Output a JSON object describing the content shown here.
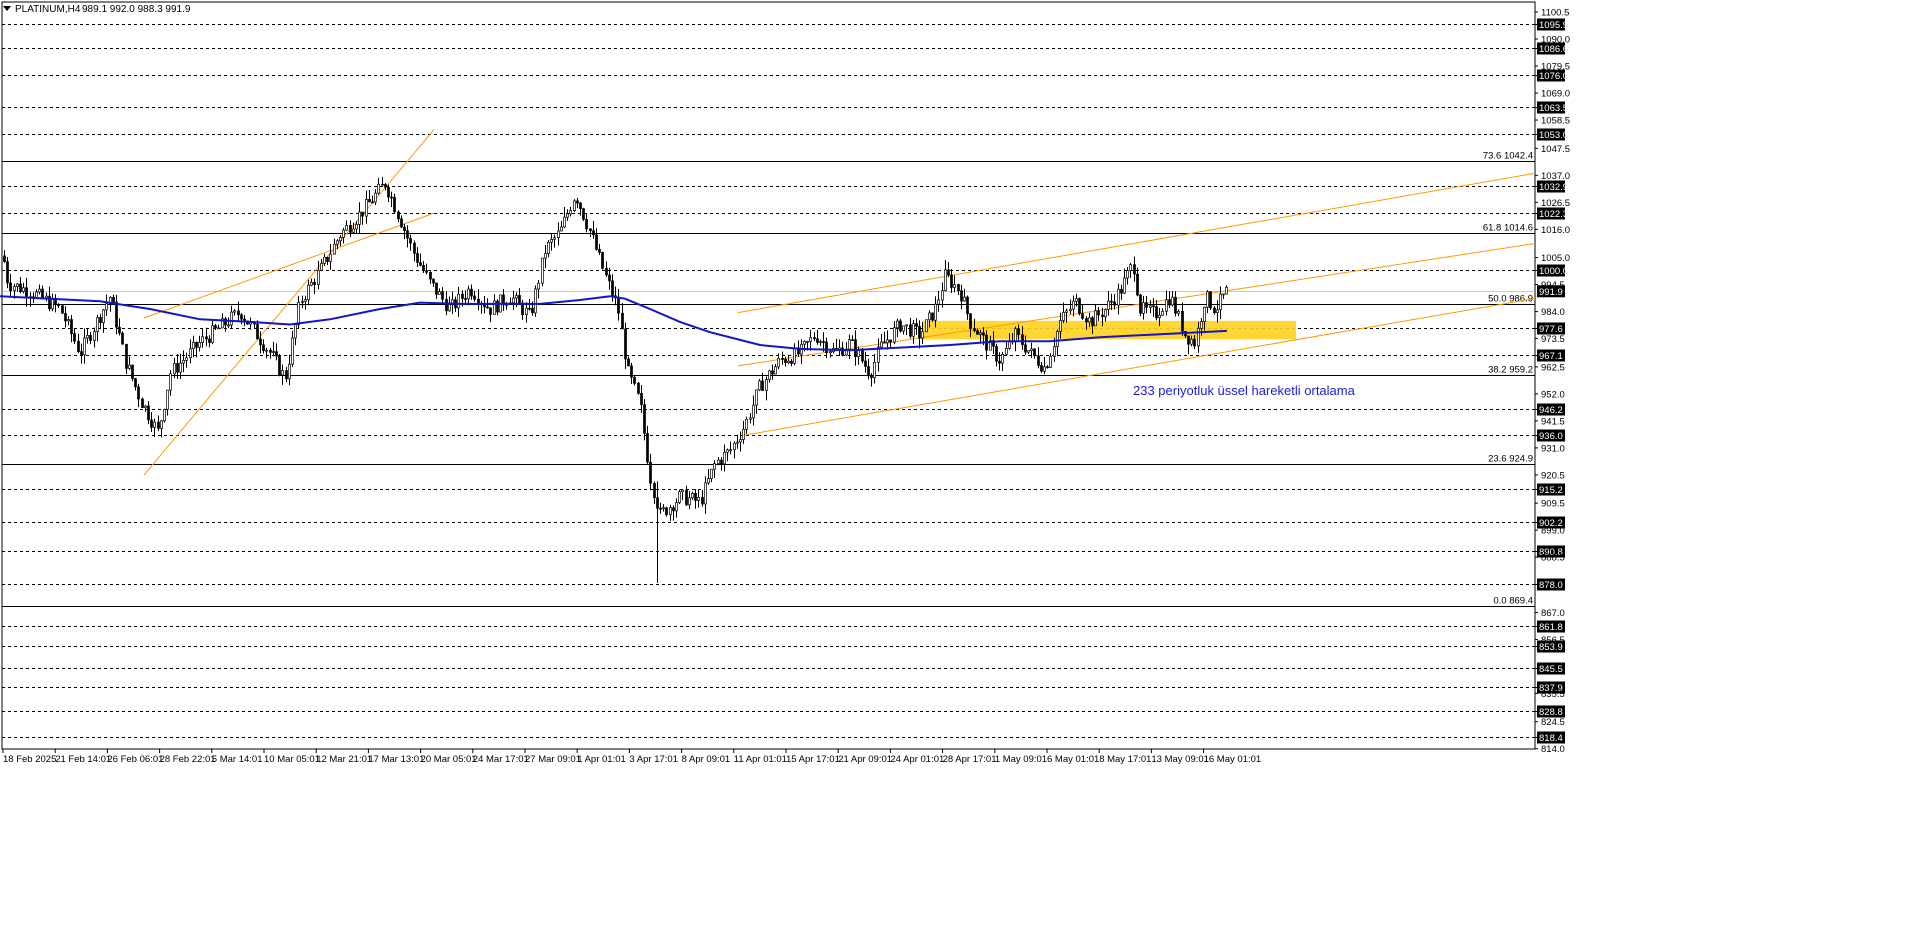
{
  "header": {
    "symbol": "PLATINUM,H4",
    "ohlc": "989.1 992.0 988.3 991.9"
  },
  "colors": {
    "candle": "#000000",
    "ema": "#1414c8",
    "channel": "#ff9900",
    "zone": "#ffd21e",
    "grid": "#000000",
    "note": "#1c1ce0"
  },
  "chart_data": {
    "type": "candlestick",
    "annotation": "233 periyotluk üssel hareketli ortalama",
    "ylim": [
      813.9,
      1104.4
    ],
    "y_ticks": [
      {
        "v": 1100.5,
        "t": "1100.5"
      },
      {
        "v": 1090.0,
        "t": "1090.0"
      },
      {
        "v": 1079.5,
        "t": "1079.5"
      },
      {
        "v": 1069.0,
        "t": "1069.0"
      },
      {
        "v": 1058.5,
        "t": "1058.5"
      },
      {
        "v": 1047.5,
        "t": "1047.5"
      },
      {
        "v": 1037.0,
        "t": "1037.0"
      },
      {
        "v": 1026.5,
        "t": "1026.5"
      },
      {
        "v": 1016.0,
        "t": "1016.0"
      },
      {
        "v": 1005.0,
        "t": "1005.0"
      },
      {
        "v": 994.5,
        "t": "994.5"
      },
      {
        "v": 984.0,
        "t": "984.0"
      },
      {
        "v": 973.5,
        "t": "973.5"
      },
      {
        "v": 962.5,
        "t": "962.5"
      },
      {
        "v": 952.0,
        "t": "952.0"
      },
      {
        "v": 941.5,
        "t": "941.5"
      },
      {
        "v": 931.0,
        "t": "931.0"
      },
      {
        "v": 920.5,
        "t": "920.5"
      },
      {
        "v": 909.5,
        "t": "909.5"
      },
      {
        "v": 899.0,
        "t": "899.0"
      },
      {
        "v": 888.5,
        "t": "888.5"
      },
      {
        "v": 867.0,
        "t": "867.0"
      },
      {
        "v": 856.5,
        "t": "856.5"
      },
      {
        "v": 835.5,
        "t": "835.5"
      },
      {
        "v": 824.5,
        "t": "824.5"
      },
      {
        "v": 814.0,
        "t": "814.0"
      }
    ],
    "dashed_levels": [
      {
        "v": 1095.9,
        "t": "1095.9"
      },
      {
        "v": 1086.6,
        "t": "1086.6"
      },
      {
        "v": 1076.0,
        "t": "1076.0"
      },
      {
        "v": 1063.5,
        "t": "1063.5"
      },
      {
        "v": 1053.0,
        "t": "1053.0"
      },
      {
        "v": 1032.9,
        "t": "1032.9"
      },
      {
        "v": 1022.3,
        "t": "1022.3"
      },
      {
        "v": 1000.0,
        "t": "1000.0"
      },
      {
        "v": 977.6,
        "t": "977.6"
      },
      {
        "v": 967.1,
        "t": "967.1"
      },
      {
        "v": 946.2,
        "t": "946.2"
      },
      {
        "v": 936.0,
        "t": "936.0"
      },
      {
        "v": 915.2,
        "t": "915.2"
      },
      {
        "v": 902.2,
        "t": "902.2"
      },
      {
        "v": 890.8,
        "t": "890.8"
      },
      {
        "v": 878.0,
        "t": "878.0"
      },
      {
        "v": 861.8,
        "t": "861.8"
      },
      {
        "v": 853.9,
        "t": "853.9"
      },
      {
        "v": 845.5,
        "t": "845.5"
      },
      {
        "v": 837.9,
        "t": "837.9"
      },
      {
        "v": 828.8,
        "t": "828.8"
      },
      {
        "v": 818.4,
        "t": "818.4"
      }
    ],
    "current_price": {
      "v": 991.9,
      "t": "991.9"
    },
    "fib_levels": [
      {
        "v": 1042.4,
        "t": "73.6 1042.4"
      },
      {
        "v": 1014.6,
        "t": "61.8 1014.6"
      },
      {
        "v": 986.9,
        "t": "50.0 986.9"
      },
      {
        "v": 959.2,
        "t": "38.2 959.2"
      },
      {
        "v": 924.9,
        "t": "23.6 924.9"
      },
      {
        "v": 869.4,
        "t": "0.0 869.4"
      }
    ],
    "x_labels": [
      "18 Feb 2025",
      "21 Feb 14:01",
      "26 Feb 06:01",
      "28 Feb 22:01",
      "5 Mar 14:01",
      "10 Mar 05:01",
      "12 Mar 21:01",
      "17 Mar 13:01",
      "20 Mar 05:01",
      "24 Mar 17:01",
      "27 Mar 09:01",
      "1 Apr 01:01",
      "3 Apr 17:01",
      "8 Apr 09:01",
      "11 Apr 01:01",
      "15 Apr 17:01",
      "21 Apr 09:01",
      "24 Apr 01:01",
      "28 Apr 17:01",
      "1 May 09:01",
      "6 May 01:01",
      "8 May 17:01",
      "13 May 09:01",
      "16 May 01:01"
    ],
    "price_path": [
      [
        0,
        1012
      ],
      [
        8,
        995
      ],
      [
        30,
        992
      ],
      [
        60,
        985
      ],
      [
        80,
        968
      ],
      [
        110,
        990
      ],
      [
        125,
        965
      ],
      [
        140,
        950
      ],
      [
        158,
        937
      ],
      [
        170,
        960
      ],
      [
        200,
        972
      ],
      [
        240,
        984
      ],
      [
        270,
        968
      ],
      [
        285,
        958
      ],
      [
        300,
        988
      ],
      [
        320,
        1000
      ],
      [
        340,
        1014
      ],
      [
        360,
        1022
      ],
      [
        385,
        1034
      ],
      [
        400,
        1020
      ],
      [
        412,
        1008
      ],
      [
        430,
        995
      ],
      [
        450,
        985
      ],
      [
        470,
        993
      ],
      [
        490,
        985
      ],
      [
        510,
        990
      ],
      [
        530,
        982
      ],
      [
        545,
        1008
      ],
      [
        560,
        1015
      ],
      [
        575,
        1030
      ],
      [
        590,
        1015
      ],
      [
        605,
        998
      ],
      [
        618,
        985
      ],
      [
        628,
        960
      ],
      [
        640,
        948
      ],
      [
        650,
        920
      ],
      [
        660,
        905
      ],
      [
        680,
        912
      ],
      [
        700,
        910
      ],
      [
        715,
        925
      ],
      [
        730,
        930
      ],
      [
        745,
        940
      ],
      [
        760,
        955
      ],
      [
        780,
        965
      ],
      [
        800,
        968
      ],
      [
        815,
        975
      ],
      [
        835,
        968
      ],
      [
        850,
        972
      ],
      [
        870,
        960
      ],
      [
        880,
        970
      ],
      [
        900,
        979
      ],
      [
        920,
        975
      ],
      [
        935,
        985
      ],
      [
        945,
        998
      ],
      [
        960,
        992
      ],
      [
        970,
        980
      ],
      [
        985,
        972
      ],
      [
        1000,
        965
      ],
      [
        1015,
        975
      ],
      [
        1030,
        968
      ],
      [
        1045,
        962
      ],
      [
        1060,
        980
      ],
      [
        1075,
        988
      ],
      [
        1090,
        980
      ],
      [
        1105,
        985
      ],
      [
        1120,
        992
      ],
      [
        1133,
        1003
      ],
      [
        1140,
        985
      ],
      [
        1155,
        983
      ],
      [
        1170,
        990
      ],
      [
        1185,
        975
      ],
      [
        1195,
        972
      ],
      [
        1205,
        990
      ],
      [
        1215,
        985
      ],
      [
        1227,
        991.9
      ]
    ],
    "ema": [
      [
        0,
        990
      ],
      [
        50,
        989
      ],
      [
        100,
        988
      ],
      [
        150,
        985
      ],
      [
        200,
        981
      ],
      [
        250,
        980
      ],
      [
        290,
        979
      ],
      [
        330,
        981
      ],
      [
        380,
        985
      ],
      [
        420,
        987.5
      ],
      [
        460,
        987
      ],
      [
        500,
        987
      ],
      [
        540,
        987
      ],
      [
        580,
        988.5
      ],
      [
        610,
        990
      ],
      [
        625,
        989
      ],
      [
        650,
        985
      ],
      [
        680,
        980
      ],
      [
        710,
        976
      ],
      [
        740,
        973
      ],
      [
        760,
        971
      ],
      [
        800,
        969.5
      ],
      [
        850,
        969
      ],
      [
        900,
        970
      ],
      [
        950,
        971
      ],
      [
        1000,
        972.5
      ],
      [
        1050,
        972.5
      ],
      [
        1100,
        974
      ],
      [
        1150,
        975
      ],
      [
        1200,
        976
      ],
      [
        1227,
        976.5
      ]
    ],
    "zone": {
      "x0": 922,
      "x1": 1296,
      "top": 980.4,
      "bottom": 973.2
    },
    "channels": [
      {
        "x1": 144,
        "y1": 920.5,
        "x2": 434,
        "y2": 1054.8
      },
      {
        "x1": 144,
        "y1": 981.5,
        "x2": 434,
        "y2": 1022.3
      },
      {
        "x1": 738,
        "y1": 983.6,
        "x2": 1535,
        "y2": 1037.8
      },
      {
        "x1": 738,
        "y1": 962.9,
        "x2": 1535,
        "y2": 1010.5
      },
      {
        "x1": 744,
        "y1": 935.9,
        "x2": 1535,
        "y2": 989.1
      }
    ]
  }
}
